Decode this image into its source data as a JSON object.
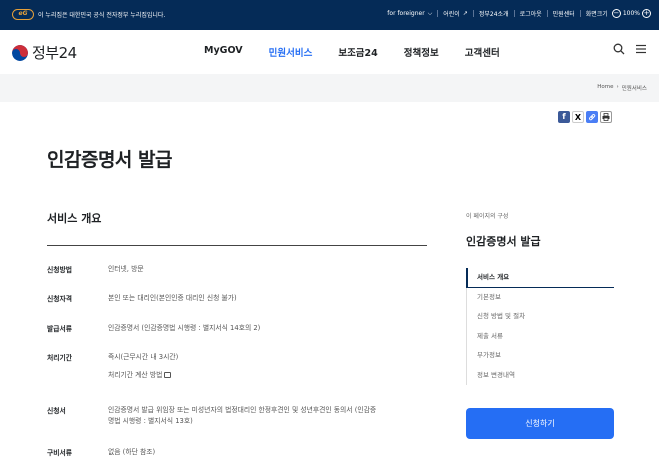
{
  "gov_bar": {
    "logo_text": "eG",
    "notice": "이 누리집은 대한민국 공식 전자정부 누리집입니다.",
    "links": [
      "for foreigner",
      "어린이",
      "정부24소개",
      "로그아웃",
      "민원센터"
    ],
    "zoom_label": "화면크기",
    "zoom_value": "100%",
    "zoom_minus": "−",
    "zoom_plus": "+"
  },
  "header": {
    "brand": "정부24",
    "nav": [
      "MyGOV",
      "민원서비스",
      "보조금24",
      "정책정보",
      "고객센터"
    ],
    "active_nav_index": 1,
    "search_icon": "search-icon",
    "menu_icon": "menu-icon"
  },
  "breadcrumb": [
    "Home",
    "민원서비스"
  ],
  "share": {
    "facebook": "f",
    "x": "X",
    "link": "🔗",
    "print": "⎙"
  },
  "page_title": "인감증명서 발급",
  "overview": {
    "title": "서비스 개요",
    "rows": [
      {
        "label": "신청방법",
        "value": "인터넷, 방문"
      },
      {
        "label": "신청자격",
        "value": "본인 또는 대리인(본인인증 대리인 신청 불가)"
      },
      {
        "label": "발급서류",
        "value": "인감증명서 (인감증명법 시행령 : 별지서식 14호의 2)"
      },
      {
        "label": "처리기간",
        "value": "즉시(근무시간 내 3시간)",
        "value2": "처리기간 계산 방법"
      },
      {
        "label": "신청서",
        "value": "인감증명서 발급 위임장 또는 미성년자의 법정대리인 한정후견인 및 성년후견인 동의서 (인감증",
        "value2": "명법 시행령 : 별지서식 13호)"
      },
      {
        "label": "구비서류",
        "value": "없음 (하단 참조)"
      }
    ]
  },
  "sidebar": {
    "caption": "이 페이지의 구성",
    "title": "인감증명서 발급",
    "toc": [
      "서비스 개요",
      "기본정보",
      "신청 방법 및 절차",
      "제출 서류",
      "부가정보",
      "정보 변경내역"
    ],
    "active_index": 0,
    "apply_label": "신청하기"
  },
  "colors": {
    "gov_bar": "#052b57",
    "accent": "#256ef4",
    "crumb_bg": "#f4f5f6"
  }
}
